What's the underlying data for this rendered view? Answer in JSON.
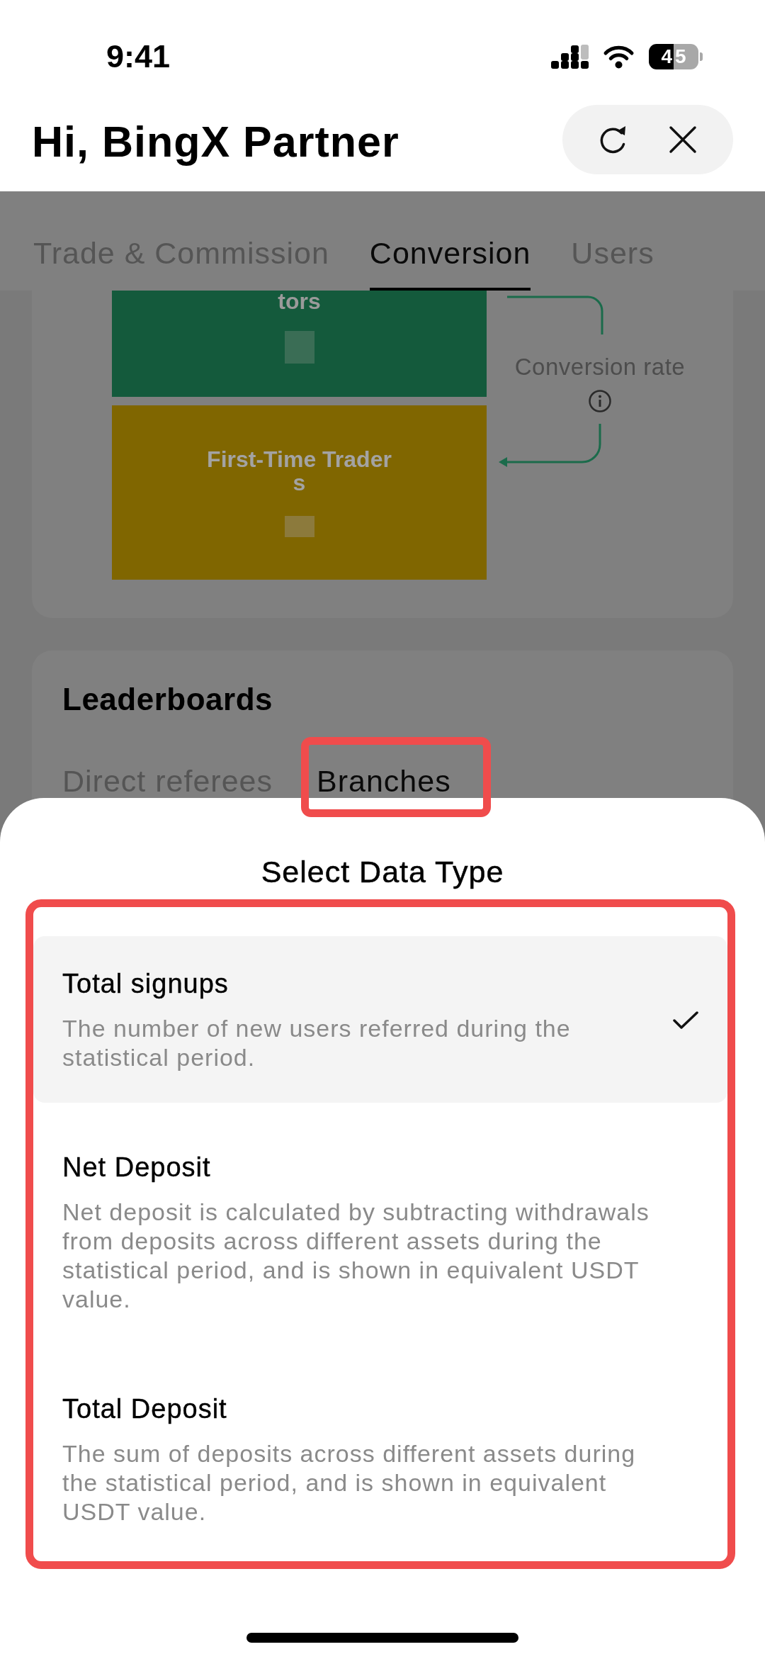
{
  "status_bar": {
    "time": "9:41",
    "battery": "45"
  },
  "header": {
    "title": "Hi, BingX Partner"
  },
  "tabs": [
    {
      "label": "Trade & Commission",
      "selected": false
    },
    {
      "label": "Conversion",
      "selected": true
    },
    {
      "label": "Users",
      "selected": false
    }
  ],
  "funnel": {
    "stages": [
      {
        "label": "tors",
        "color": "#145a3c"
      },
      {
        "label": "First-Time Traders",
        "color": "#806600"
      }
    ],
    "conversion_label": "Conversion rate"
  },
  "leaderboards": {
    "title": "Leaderboards",
    "tabs": [
      {
        "label": "Direct referees",
        "selected": false,
        "highlighted": false
      },
      {
        "label": "Branches",
        "selected": true,
        "highlighted": true
      }
    ]
  },
  "data_type_sheet": {
    "title": "Select Data Type",
    "highlighted": true,
    "options": [
      {
        "title": "Total signups",
        "description": "The number of new users referred during the statistical period.",
        "selected": true
      },
      {
        "title": "Net Deposit",
        "description": "Net deposit is calculated by subtracting withdrawals from deposits across different assets during the statistical period, and is shown in equivalent USDT value.",
        "selected": false
      },
      {
        "title": "Total Deposit",
        "description": "The sum of deposits across different assets during the statistical period, and is shown in equivalent USDT value.",
        "selected": false
      }
    ]
  }
}
